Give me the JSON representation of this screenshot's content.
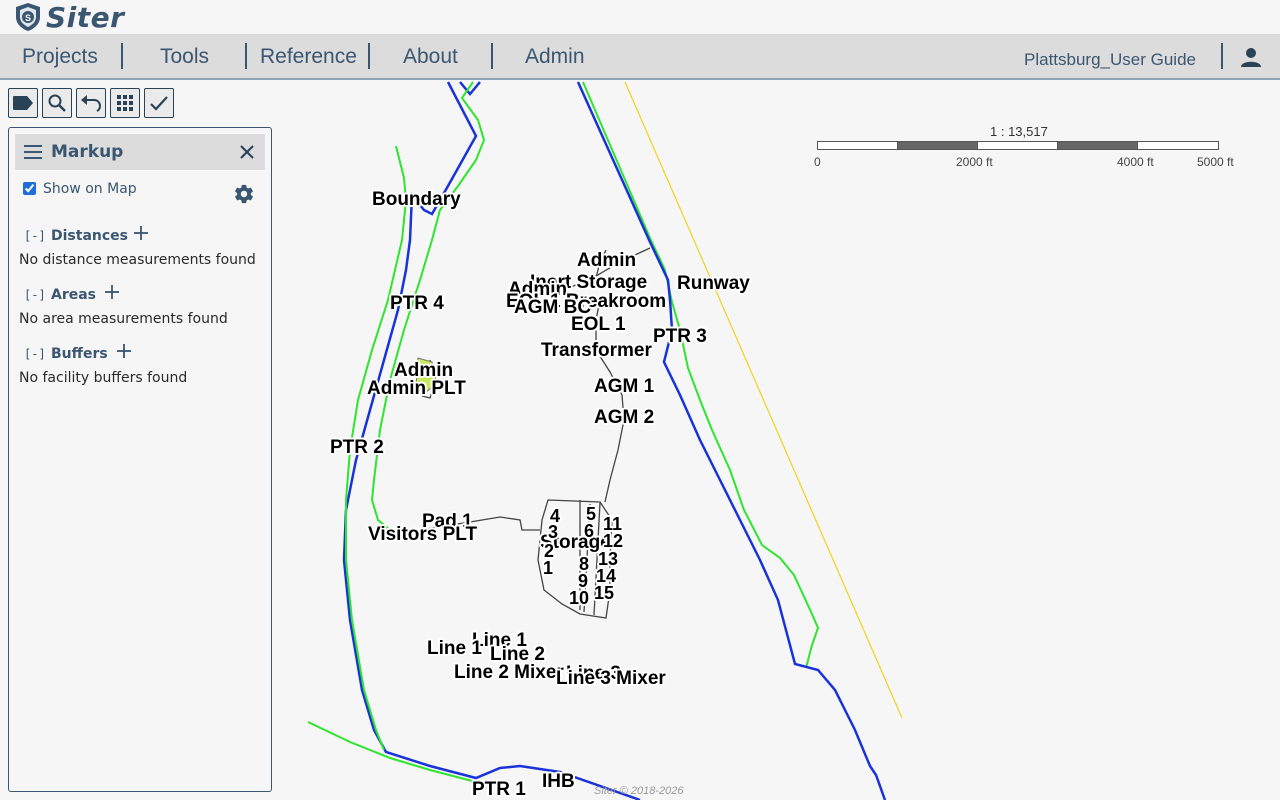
{
  "brand": {
    "name": "Siter"
  },
  "nav": {
    "items": [
      {
        "label": "Projects"
      },
      {
        "label": "Tools"
      },
      {
        "label": "Reference"
      },
      {
        "label": "About"
      },
      {
        "label": "Admin"
      }
    ],
    "user_guide": "Plattsburg_User Guide"
  },
  "toolbar": {
    "icons": [
      "tag-icon",
      "search-icon",
      "undo-icon",
      "grid-icon",
      "check-icon"
    ]
  },
  "markup": {
    "title": "Markup",
    "show_on_map_label": "Show on Map",
    "show_on_map_checked": true,
    "sections": [
      {
        "toggle": "[-]",
        "title": "Distances",
        "empty_text": "No distance measurements found"
      },
      {
        "toggle": "[-]",
        "title": "Areas",
        "empty_text": "No area measurements found"
      },
      {
        "toggle": "[-]",
        "title": "Buffers",
        "empty_text": "No facility buffers found"
      }
    ]
  },
  "map": {
    "labels": [
      "Boundary",
      "Admin",
      "Inert Storage",
      "Runway",
      "Admin",
      "EOL 1 Breakroom",
      "AGM BC",
      "EOL 1",
      "PTR 3",
      "PTR 4",
      "Transformer",
      "Admin",
      "Admin PLT",
      "AGM 1",
      "AGM 2",
      "PTR 2",
      "Pad 1",
      "Visitors PLT",
      "Storage",
      "Line 1",
      "Line 1",
      "Line 2",
      "Line 2 Mixer",
      "Line 3",
      "Line 3 Mixer",
      "PTR 1",
      "IHB"
    ],
    "pad_numbers": [
      "4",
      "5",
      "3",
      "6",
      "11",
      "2",
      "12",
      "8",
      "13",
      "1",
      "9",
      "14",
      "10",
      "15"
    ],
    "colors": {
      "boundary_blue": "#1a33d9",
      "boundary_green": "#2ee52e",
      "road": "#444444",
      "runway_line": "#f2d21c"
    }
  },
  "scale": {
    "ratio": "1 : 13,517",
    "ticks": [
      "0",
      "2000 ft",
      "4000 ft",
      "5000 ft"
    ]
  },
  "footer": {
    "copyright": "Siter © 2018-2026"
  }
}
